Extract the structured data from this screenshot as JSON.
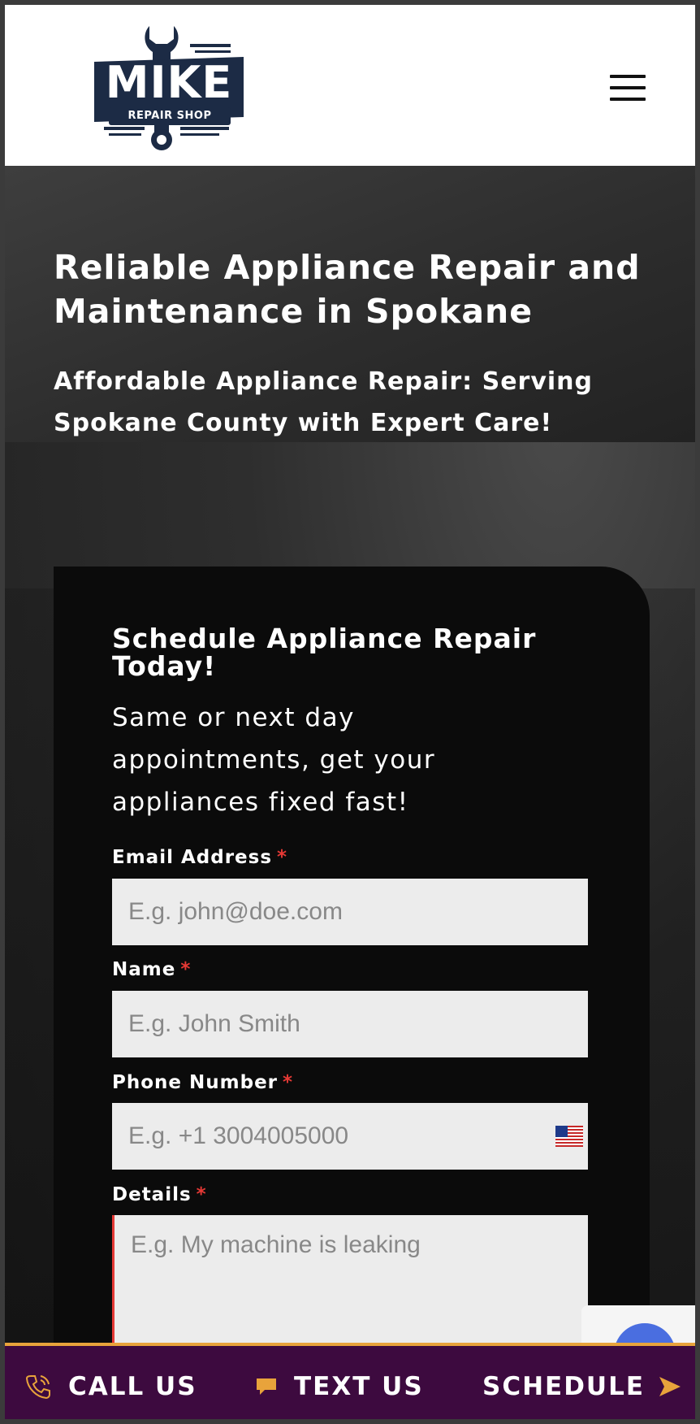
{
  "header": {
    "logo_word": "MIKE",
    "logo_sub": "REPAIR SHOP"
  },
  "hero": {
    "title": "Reliable Appliance Repair and Maintenance in Spokane",
    "subtitle": "Affordable Appliance Repair: Serving Spokane County with Expert Care!"
  },
  "form": {
    "title": "Schedule Appliance Repair Today!",
    "lead": "Same or next day appointments, get your appliances fixed fast!",
    "required_mark": "*",
    "email": {
      "label": "Email Address",
      "placeholder": "E.g. john@doe.com"
    },
    "name": {
      "label": "Name",
      "placeholder": "E.g. John Smith"
    },
    "phone": {
      "label": "Phone Number",
      "placeholder": "E.g. +1 3004005000"
    },
    "details": {
      "label": "Details",
      "placeholder": "E.g. My machine is leaking"
    }
  },
  "bottom_bar": {
    "call": "CALL US",
    "text": "TEXT US",
    "schedule": "SCHEDULE"
  },
  "colors": {
    "bar_bg": "#3d0a3f",
    "bar_accent": "#e8a33b",
    "logo_navy": "#1c2b45",
    "required_red": "#e53935"
  },
  "icons": {
    "call": "phone-icon",
    "text": "chat-bubble-icon",
    "schedule": "arrow-right-icon",
    "menu": "hamburger-menu-icon",
    "flag": "us-flag-icon"
  }
}
